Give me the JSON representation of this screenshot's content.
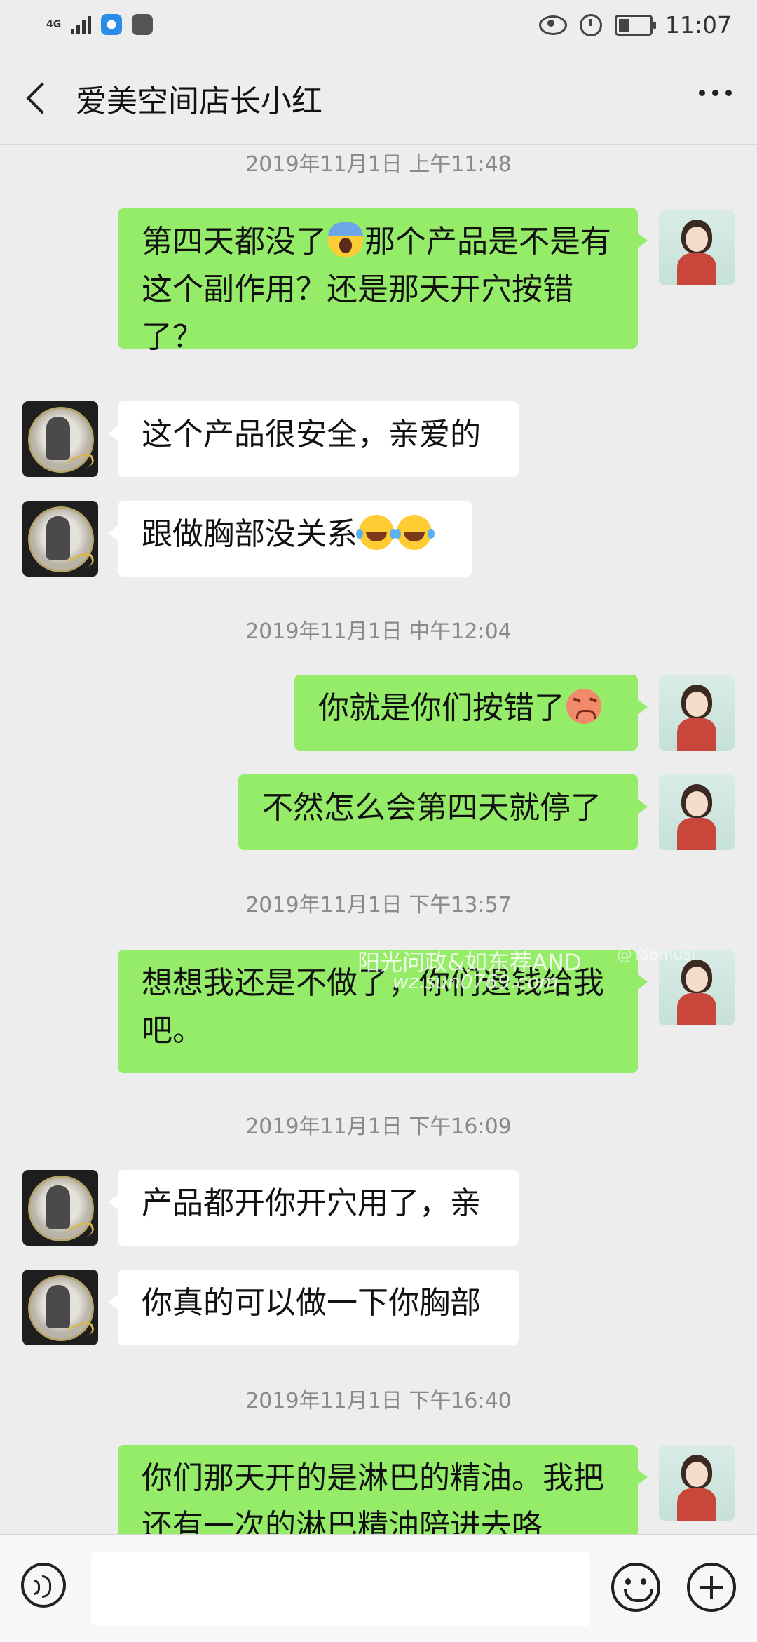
{
  "status_bar": {
    "network": "4G",
    "time": "11:07"
  },
  "header": {
    "title": "爱美空间店长小红"
  },
  "messages": [
    {
      "type": "timestamp",
      "text": "2019年11月1日 上午11:48"
    },
    {
      "type": "me",
      "parts": [
        "第四天都没了",
        "那个产品是不是有这个副作用？还是那天开穴按错了？"
      ],
      "emoji": "scream"
    },
    {
      "type": "other",
      "text": "这个产品很安全，亲爱的"
    },
    {
      "type": "other",
      "text": "跟做胸部没关系",
      "emoji": "laugh-crying x2"
    },
    {
      "type": "timestamp",
      "text": "2019年11月1日 中午12:04"
    },
    {
      "type": "me",
      "text": "你就是你们按错了",
      "emoji": "angry"
    },
    {
      "type": "me",
      "text": "不然怎么会第四天就停了"
    },
    {
      "type": "timestamp",
      "text": "2019年11月1日 下午13:57"
    },
    {
      "type": "me",
      "text": "想想我还是不做了，你们退钱给我吧。"
    },
    {
      "type": "timestamp",
      "text": "2019年11月1日 下午16:09"
    },
    {
      "type": "other",
      "text": "产品都开你开穴用了，亲"
    },
    {
      "type": "other",
      "text": "你真的可以做一下你胸部"
    },
    {
      "type": "timestamp",
      "text": "2019年11月1日 下午16:40"
    },
    {
      "type": "me",
      "text": "你们那天开的是淋巴的精油。我把还有一次的淋巴精油陪进去咯"
    }
  ],
  "watermark": {
    "line1": "阳光问政&如东荐AND",
    "line2": "wz.sun0769.com",
    "line3": "@Yaomusi"
  },
  "colors": {
    "my_bubble": "#95ec69",
    "other_bubble": "#ffffff",
    "background": "#ededed"
  }
}
